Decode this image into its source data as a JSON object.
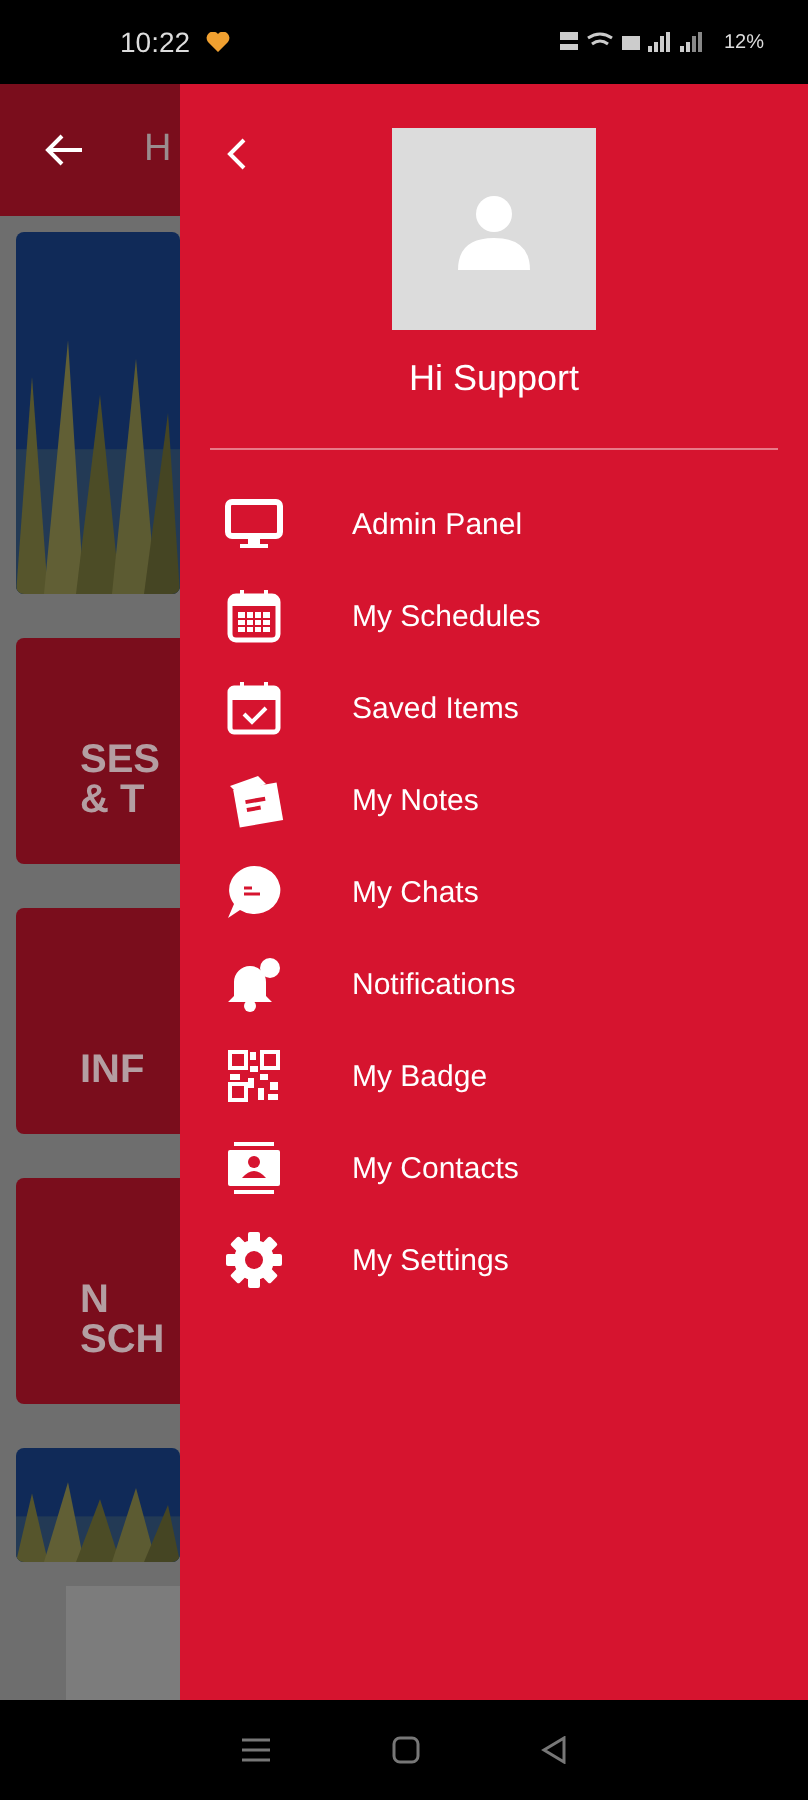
{
  "status_bar": {
    "time": "10:22",
    "battery": "12%"
  },
  "background": {
    "header_title": "H",
    "tiles": [
      {
        "kind": "picture"
      },
      {
        "kind": "tile",
        "lines": [
          "SES",
          "& T"
        ]
      },
      {
        "kind": "tile",
        "lines": [
          "INF"
        ]
      },
      {
        "kind": "tile",
        "lines": [
          "N",
          "SCH"
        ]
      },
      {
        "kind": "picture"
      },
      {
        "kind": "card"
      }
    ]
  },
  "drawer": {
    "greeting": "Hi Support",
    "menu": [
      {
        "label": "Admin Panel"
      },
      {
        "label": "My Schedules"
      },
      {
        "label": "Saved Items"
      },
      {
        "label": "My Notes"
      },
      {
        "label": "My Chats"
      },
      {
        "label": "Notifications"
      },
      {
        "label": "My Badge"
      },
      {
        "label": "My Contacts"
      },
      {
        "label": "My Settings"
      }
    ]
  }
}
